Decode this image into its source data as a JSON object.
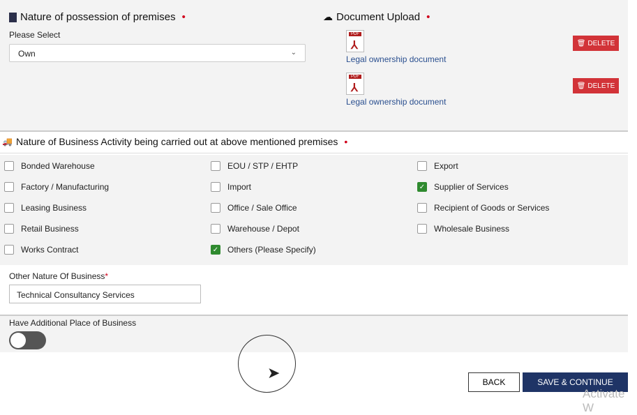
{
  "possession": {
    "title": "Nature of possession of premises",
    "required": "•",
    "label": "Please Select",
    "value": "Own"
  },
  "upload": {
    "title": "Document Upload",
    "required": "•",
    "documents": [
      {
        "name": "Legal ownership document",
        "delete_label": "DELETE"
      },
      {
        "name": "Legal ownership document",
        "delete_label": "DELETE"
      }
    ],
    "pdf_tag": "PDF"
  },
  "activity": {
    "title": "Nature of Business Activity being carried out at above mentioned premises",
    "required": "•",
    "options": [
      {
        "label": "Bonded Warehouse",
        "checked": false
      },
      {
        "label": "EOU / STP / EHTP",
        "checked": false
      },
      {
        "label": "Export",
        "checked": false
      },
      {
        "label": "Factory / Manufacturing",
        "checked": false
      },
      {
        "label": "Import",
        "checked": false
      },
      {
        "label": "Supplier of Services",
        "checked": true
      },
      {
        "label": "Leasing Business",
        "checked": false
      },
      {
        "label": "Office / Sale Office",
        "checked": false
      },
      {
        "label": "Recipient of Goods or Services",
        "checked": false
      },
      {
        "label": "Retail Business",
        "checked": false
      },
      {
        "label": "Warehouse / Depot",
        "checked": false
      },
      {
        "label": "Wholesale Business",
        "checked": false
      },
      {
        "label": "Works Contract",
        "checked": false
      },
      {
        "label": "Others (Please Specify)",
        "checked": true
      }
    ]
  },
  "other": {
    "label": "Other Nature Of Business",
    "required": "*",
    "value": "Technical Consultancy Services"
  },
  "additional": {
    "label": "Have Additional Place of Business",
    "enabled": false
  },
  "buttons": {
    "back": "BACK",
    "save": "SAVE & CONTINUE"
  },
  "watermark": "Activate W",
  "colors": {
    "delete": "#d23338",
    "save": "#1f3466",
    "checked": "#2f8a2f",
    "link": "#2a4f8f"
  }
}
